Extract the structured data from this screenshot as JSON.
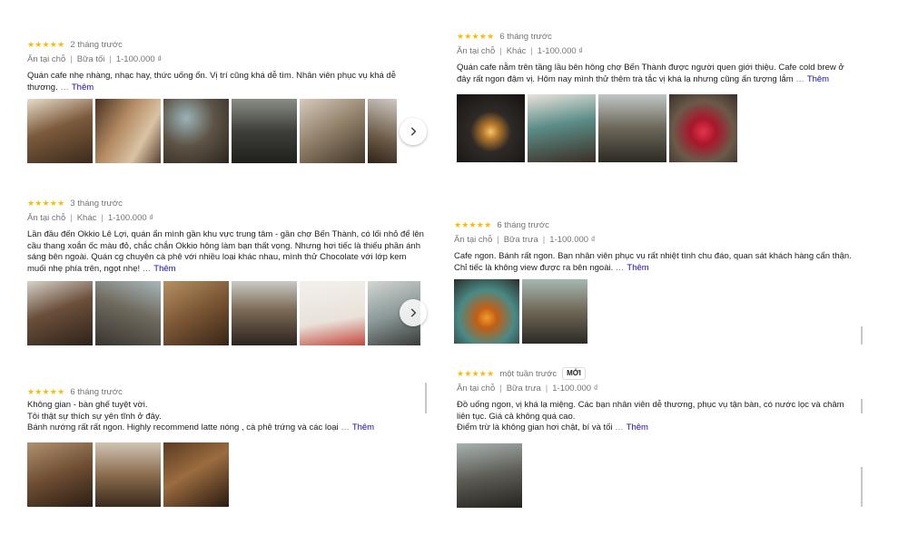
{
  "labels": {
    "more": "Thêm",
    "ellipsis": "…"
  },
  "reviews": [
    {
      "stars": "★★★★★",
      "time": "2 tháng trước",
      "meta": [
        "Ăn tại chỗ",
        "Bữa tối",
        "1-100.000 ₫"
      ],
      "text": [
        "Quán cafe nhẹ nhàng, nhạc hay, thức uống ổn. Vị trí cũng khá dễ tìm. Nhân viên phục vụ khá dễ",
        "thương."
      ],
      "photos": 6
    },
    {
      "stars": "★★★★★",
      "time": "6 tháng trước",
      "meta": [
        "Ăn tại chỗ",
        "Khác",
        "1-100.000 ₫"
      ],
      "text": [
        "Quán cafe nằm trên tầng lầu bên hông chợ Bến Thành được người quen giới thiệu. Cafe cold brew ở",
        "đây rất ngon đậm vị. Hôm nay mình thử thêm trà tắc vị khá lạ nhưng cũng ấn tượng lắm"
      ],
      "photos": 4
    },
    {
      "stars": "★★★★★",
      "time": "3 tháng trước",
      "meta": [
        "Ăn tại chỗ",
        "Khác",
        "1-100.000 ₫"
      ],
      "text": [
        "Lần đầu đến Okkio Lê Lợi, quán ẩn mình gần khu vực trung tâm - gần chợ Bến Thành, có lối nhỏ để lên",
        "cầu thang xoắn ốc màu đỏ, chắc chắn Okkio hông làm bạn thất vọng. Nhưng hơi tiếc là thiếu phần ánh",
        "sáng bên ngoài. Quán cg chuyên cà phê với nhiều loại khác nhau, mình thử Chocolate với lớp kem",
        "muối nhẹ phía trên, ngọt nhẹ!"
      ],
      "photos": 6
    },
    {
      "stars": "★★★★★",
      "time": "6 tháng trước",
      "meta": [
        "Ăn tại chỗ",
        "Bữa trưa",
        "1-100.000 ₫"
      ],
      "text": [
        "Cafe ngon. Bánh rất ngon. Bạn nhân viên phục vụ rất nhiệt tình chu đáo, quan sát khách hàng cẩn thận.",
        "Chỉ tiếc là không view được ra bên ngoài."
      ],
      "photos": 2
    },
    {
      "stars": "★★★★★",
      "time": "6 tháng trước",
      "meta": [],
      "text": [
        "Không gian - bàn ghế tuyệt vời.",
        "Tôi thật sự thích sự yên tĩnh ở đây.",
        "Bánh nướng rất rất ngon. Highly recommend latte nóng , cà phê trứng và các loại"
      ],
      "photos": 3
    },
    {
      "stars": "★★★★★",
      "time": "một tuần trước",
      "badge": "MỚI",
      "meta": [
        "Ăn tại chỗ",
        "Bữa trưa",
        "1-100.000 ₫"
      ],
      "text": [
        "Đồ uống ngon, vị khá lạ miệng. Các bạn nhân viên dễ thương, phục vụ tận bàn, có nước lọc và châm",
        "liên tục. Giá cả không quá cao.",
        "Điểm trừ là không gian hơi chật, bí và tối"
      ],
      "photos": 1
    }
  ]
}
